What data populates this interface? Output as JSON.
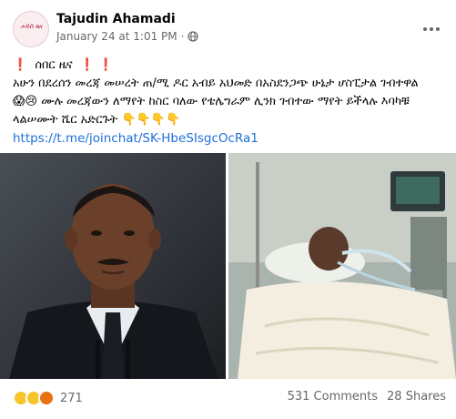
{
  "post": {
    "author": "Tajudin Ahamadi",
    "date": "January 24 at 1:01 PM",
    "separator": "·",
    "avatar_text": "ሐይሰ ዜና",
    "headline": "ሰበር ዜና",
    "body_line1": "አሁን በደረሰን መረጃ መሠረት ጠ/ሚ ዶር አብይ አህመድ በአስደንጋጭ ሁኔታ ሆስፒታል ገብተዋል",
    "body_line2": "ሙሉ መረጃውን ለማየት ከስር ባለው የቴሌግራም ሊንክ ገብተው ማየት ይችላሉ እባካቹ",
    "body_line3": "ላልሠሙት ሼር አድርጉት",
    "link": "https://t.me/joinchat/SK-HbeSIsgcOcRa1",
    "emoji_line2": "😱😢",
    "emoji_line3": "👇👇👇👇",
    "red_marks": "❗",
    "more_icon": "three-dots-icon",
    "privacy_icon": "globe-icon"
  },
  "footer": {
    "reaction_count": "271",
    "comments": "531 Comments",
    "shares": "28 Shares"
  },
  "colors": {
    "link": "#216fdb",
    "meta": "#65676b",
    "text": "#050505"
  }
}
